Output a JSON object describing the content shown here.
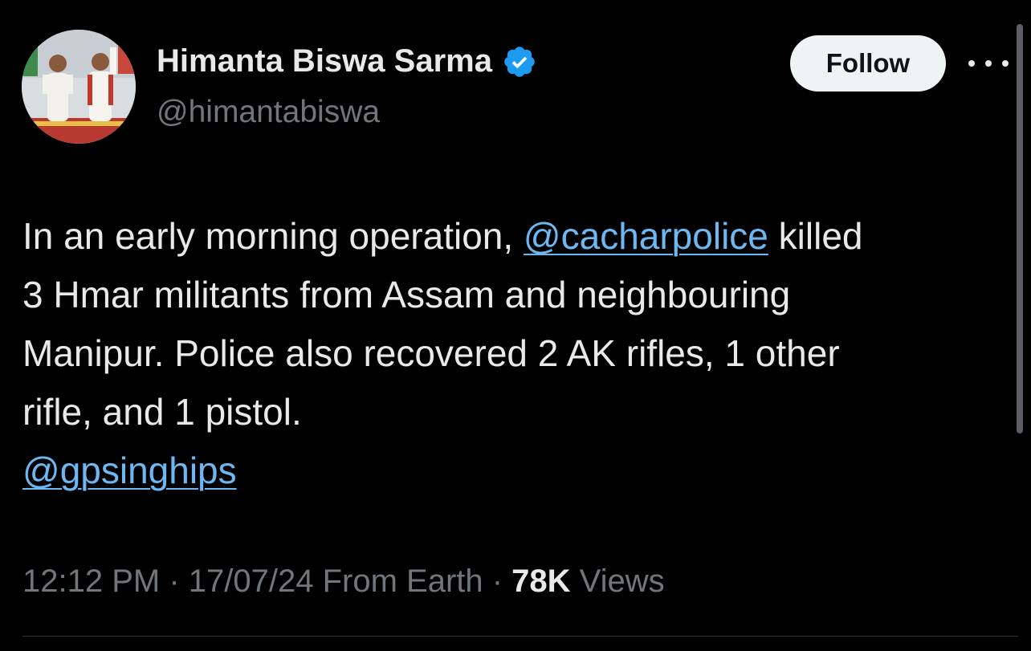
{
  "author": {
    "display_name": "Himanta Biswa Sarma",
    "handle": "@himantabiswa",
    "verified": true,
    "avatar_icon": "profile-photo"
  },
  "actions": {
    "follow_label": "Follow",
    "more_icon": "more-horizontal-icon"
  },
  "tweet": {
    "segments": {
      "l1_pre": "In an early morning operation, ",
      "mention_1": "@cacharpolice",
      "l1_post": " killed",
      "l2": "3 Hmar militants from Assam and neighbouring",
      "l3": "Manipur. Police also recovered 2 AK rifles, 1 other",
      "l4": "rifle, and 1 pistol.",
      "mention_2": "@gpsinghips"
    }
  },
  "meta": {
    "time": "12:12 PM",
    "sep1": " · ",
    "date": "17/07/24",
    "source": " From Earth",
    "sep2": " · ",
    "views_count": "78K",
    "views_label": " Views"
  },
  "colors": {
    "background": "#000000",
    "text": "#e7e9ea",
    "secondary": "#71767b",
    "link": "#6cb8f2",
    "verified_badge": "#1d9bf0"
  }
}
